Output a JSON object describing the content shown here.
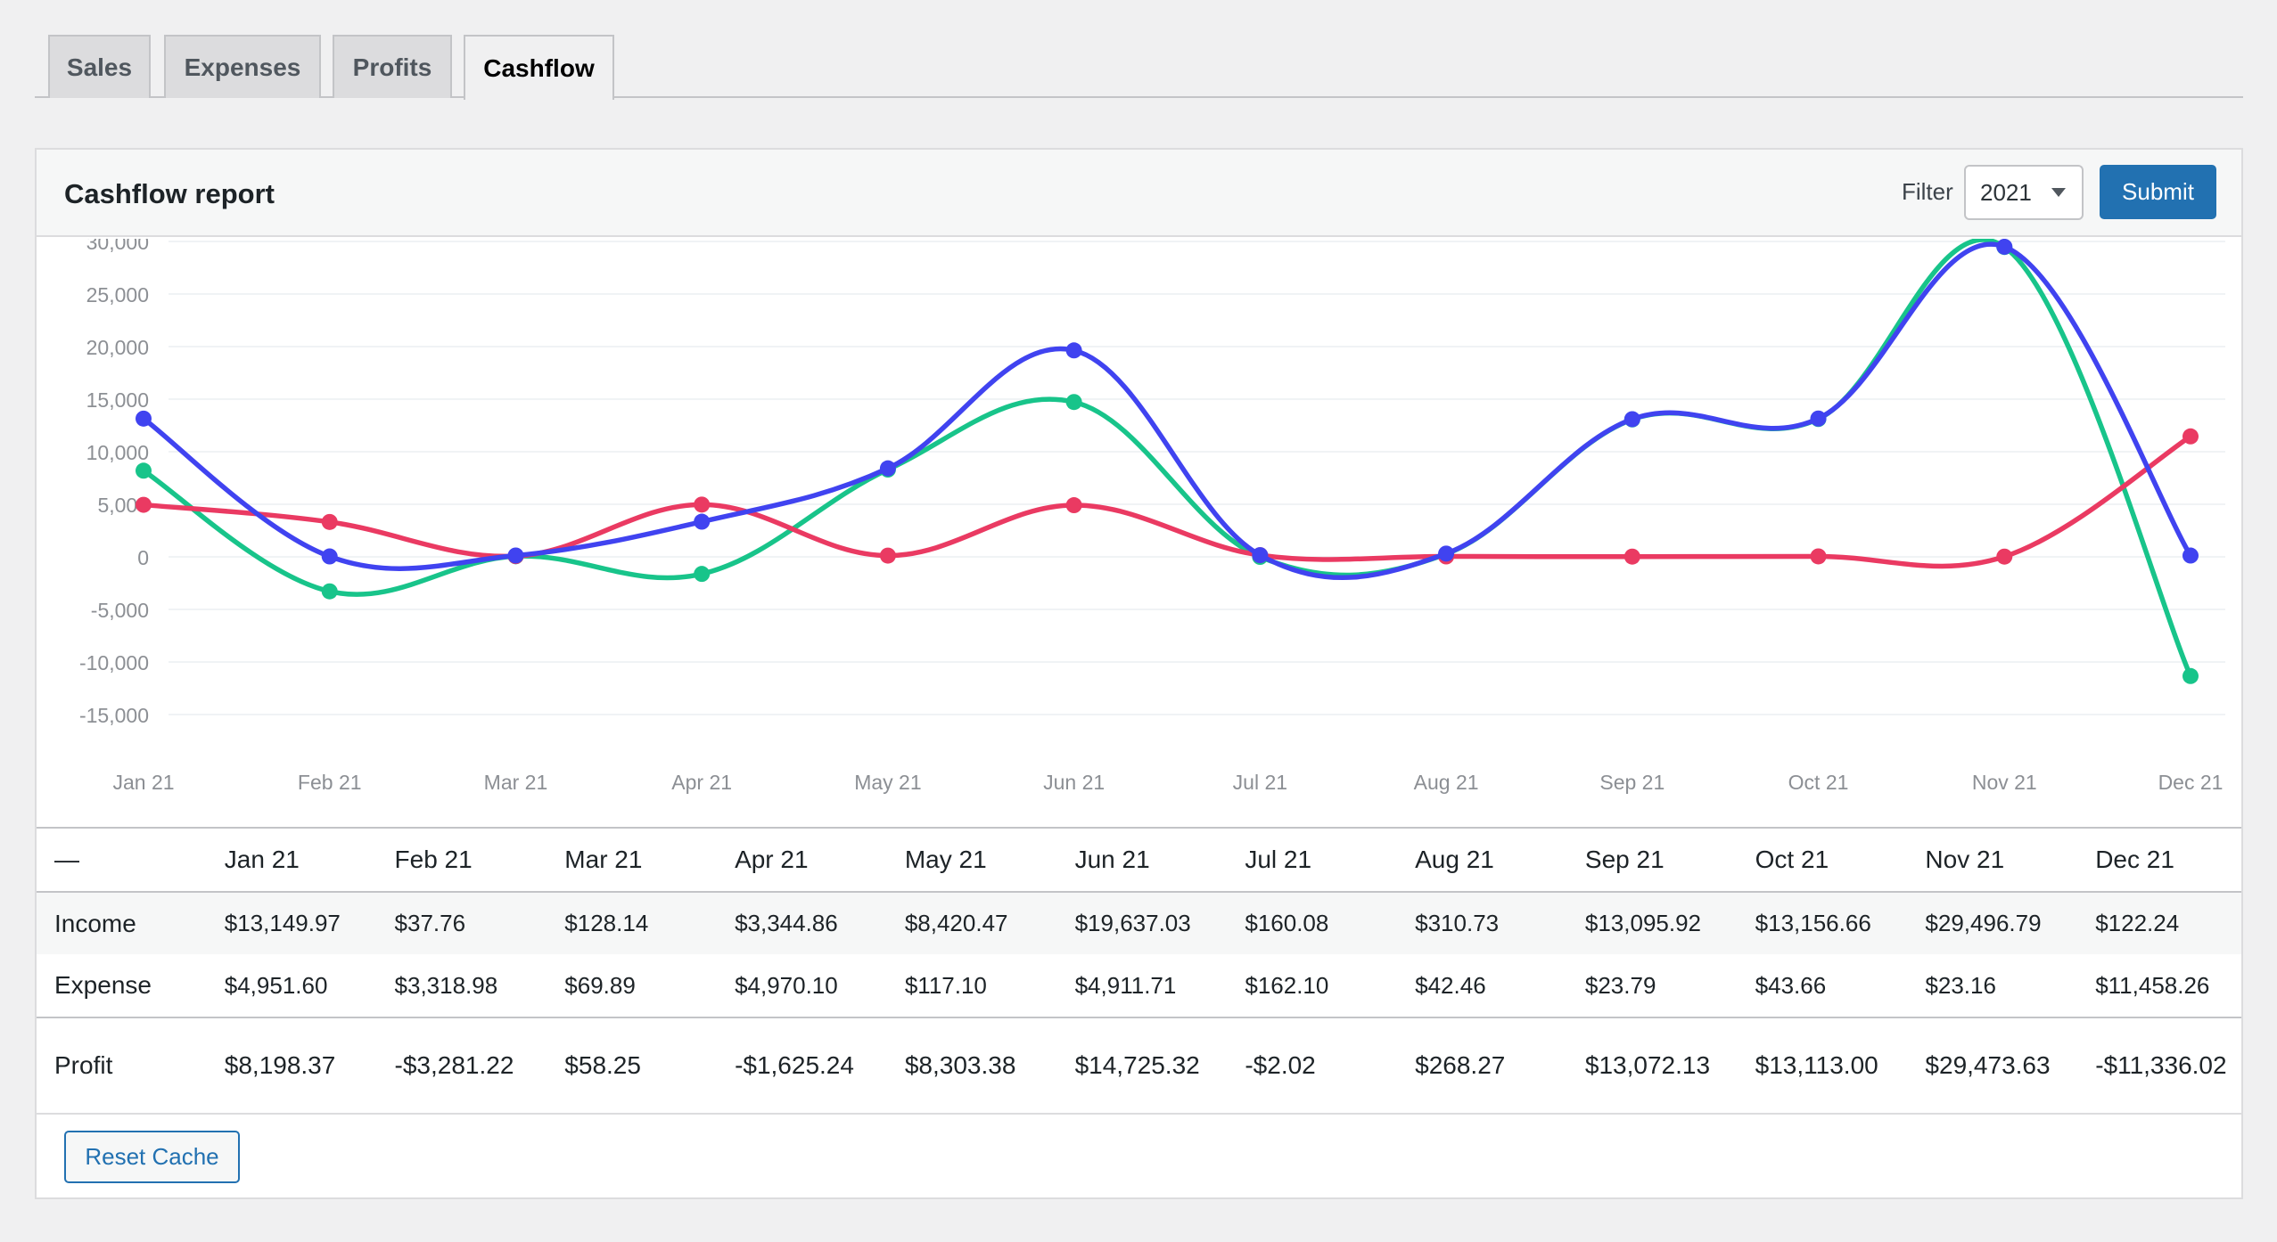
{
  "tabs": [
    {
      "label": "Sales",
      "active": false
    },
    {
      "label": "Expenses",
      "active": false
    },
    {
      "label": "Profits",
      "active": false
    },
    {
      "label": "Cashflow",
      "active": true
    }
  ],
  "report": {
    "title": "Cashflow report",
    "filter_label": "Filter",
    "year_selected": "2021",
    "submit_label": "Submit",
    "reset_cache_label": "Reset Cache"
  },
  "colors": {
    "income": "#4043f0",
    "expense": "#ea3a62",
    "profit": "#18c48a",
    "primary": "#2271b1"
  },
  "chart_data": {
    "type": "line",
    "categories": [
      "Jan 21",
      "Feb 21",
      "Mar 21",
      "Apr 21",
      "May 21",
      "Jun 21",
      "Jul 21",
      "Aug 21",
      "Sep 21",
      "Oct 21",
      "Nov 21",
      "Dec 21"
    ],
    "ylim": [
      -15000,
      30000
    ],
    "yticks": [
      30000,
      25000,
      20000,
      15000,
      10000,
      5000,
      0,
      -5000,
      -10000,
      -15000
    ],
    "ytick_labels": [
      "30,000",
      "25,000",
      "20,000",
      "15,000",
      "10,000",
      "5,000",
      "0",
      "-5,000",
      "-10,000",
      "-15,000"
    ],
    "grid": true,
    "curve": "smooth",
    "series": [
      {
        "key": "profit",
        "values": [
          8198.37,
          -3281.22,
          58.25,
          -1625.24,
          8303.38,
          14725.32,
          -2.02,
          268.27,
          13072.13,
          13113.0,
          29473.63,
          -11336.02
        ]
      },
      {
        "key": "expense",
        "values": [
          4951.6,
          3318.98,
          69.89,
          4970.1,
          117.1,
          4911.71,
          162.1,
          42.46,
          23.79,
          43.66,
          23.16,
          11458.26
        ]
      },
      {
        "key": "income",
        "values": [
          13149.97,
          37.76,
          128.14,
          3344.86,
          8420.47,
          19637.03,
          160.08,
          310.73,
          13095.92,
          13156.66,
          29496.79,
          122.24
        ]
      }
    ]
  },
  "table": {
    "corner": "—",
    "months": [
      "Jan 21",
      "Feb 21",
      "Mar 21",
      "Apr 21",
      "May 21",
      "Jun 21",
      "Jul 21",
      "Aug 21",
      "Sep 21",
      "Oct 21",
      "Nov 21",
      "Dec 21"
    ],
    "rows": [
      {
        "key": "income",
        "label": "Income",
        "cells": [
          "$13,149.97",
          "$37.76",
          "$128.14",
          "$3,344.86",
          "$8,420.47",
          "$19,637.03",
          "$160.08",
          "$310.73",
          "$13,095.92",
          "$13,156.66",
          "$29,496.79",
          "$122.24"
        ]
      },
      {
        "key": "expense",
        "label": "Expense",
        "cells": [
          "$4,951.60",
          "$3,318.98",
          "$69.89",
          "$4,970.10",
          "$117.10",
          "$4,911.71",
          "$162.10",
          "$42.46",
          "$23.79",
          "$43.66",
          "$23.16",
          "$11,458.26"
        ]
      },
      {
        "key": "profit",
        "label": "Profit",
        "cells": [
          "$8,198.37",
          "-$3,281.22",
          "$58.25",
          "-$1,625.24",
          "$8,303.38",
          "$14,725.32",
          "-$2.02",
          "$268.27",
          "$13,072.13",
          "$13,113.00",
          "$29,473.63",
          "-$11,336.02"
        ]
      }
    ]
  }
}
